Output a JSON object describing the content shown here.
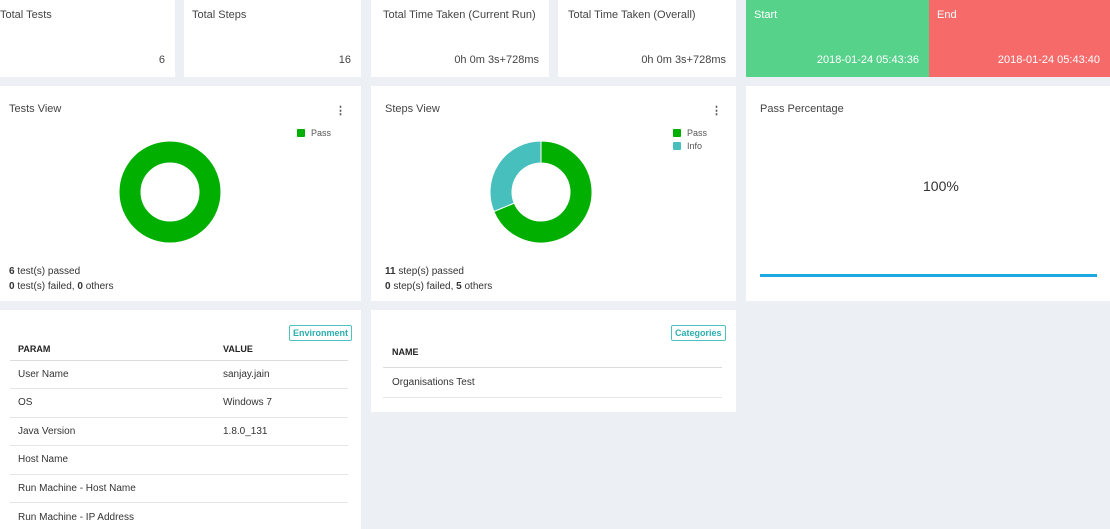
{
  "stats": {
    "total_tests": {
      "label": "Total Tests",
      "value": "6"
    },
    "total_steps": {
      "label": "Total Steps",
      "value": "16"
    },
    "time_current": {
      "label": "Total Time Taken (Current Run)",
      "value": "0h 0m 3s+728ms"
    },
    "time_overall": {
      "label": "Total Time Taken (Overall)",
      "value": "0h 0m 3s+728ms"
    },
    "start": {
      "label": "Start",
      "value": "2018-01-24 05:43:36"
    },
    "end": {
      "label": "End",
      "value": "2018-01-24 05:43:40"
    }
  },
  "tests_view": {
    "title": "Tests View",
    "menu": "⋮",
    "legend": [
      {
        "label": "Pass",
        "color": "#00af00"
      }
    ],
    "passed_count": "6",
    "passed_text": " test(s) passed",
    "failed_count": "0",
    "failed_text": " test(s) failed, ",
    "others_count": "0",
    "others_text": " others"
  },
  "steps_view": {
    "title": "Steps View",
    "menu": "⋮",
    "legend": [
      {
        "label": "Pass",
        "color": "#00af00"
      },
      {
        "label": "Info",
        "color": "#46bfbd"
      }
    ],
    "passed_count": "11",
    "passed_text": " step(s) passed",
    "failed_count": "0",
    "failed_text": " step(s) failed, ",
    "others_count": "5",
    "others_text": " others"
  },
  "pass_percentage": {
    "title": "Pass Percentage",
    "value": "100%",
    "fraction": 1.0,
    "bar_color": "#1ea7e1"
  },
  "environment": {
    "badge": "Environment",
    "col_param": "PARAM",
    "col_value": "VALUE",
    "rows": [
      {
        "param": "User Name",
        "value": "sanjay.jain"
      },
      {
        "param": "OS",
        "value": "Windows 7"
      },
      {
        "param": "Java Version",
        "value": "1.8.0_131"
      },
      {
        "param": "Host Name",
        "value": ""
      },
      {
        "param": "Run Machine - Host Name",
        "value": ""
      },
      {
        "param": "Run Machine - IP Address",
        "value": ""
      }
    ]
  },
  "categories": {
    "badge": "Categories",
    "col_name": "NAME",
    "rows": [
      {
        "name": "Organisations Test"
      }
    ]
  },
  "chart_data": [
    {
      "type": "pie",
      "categories": [
        "Pass"
      ],
      "values": [
        6
      ]
    },
    {
      "type": "pie",
      "categories": [
        "Pass",
        "Info"
      ],
      "values": [
        11,
        5
      ]
    }
  ],
  "colors": {
    "pass": "#00af00",
    "info": "#46bfbd",
    "start": "#56d28b",
    "end": "#f66a6a"
  }
}
